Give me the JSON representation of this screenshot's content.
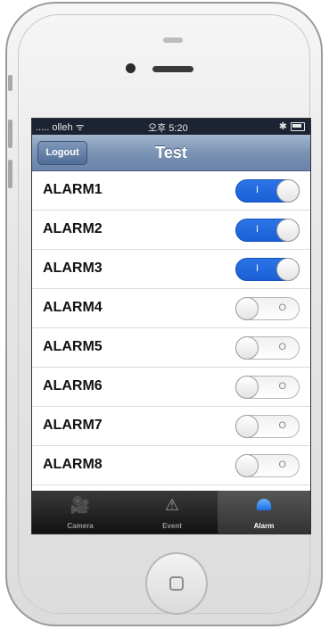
{
  "status": {
    "carrier": "..... olleh ᯤ",
    "time": "오후 5:20",
    "bluetooth": "✱"
  },
  "nav": {
    "logout_label": "Logout",
    "title": "Test"
  },
  "alarms": [
    {
      "label": "ALARM1",
      "on": true
    },
    {
      "label": "ALARM2",
      "on": true
    },
    {
      "label": "ALARM3",
      "on": true
    },
    {
      "label": "ALARM4",
      "on": false
    },
    {
      "label": "ALARM5",
      "on": false
    },
    {
      "label": "ALARM6",
      "on": false
    },
    {
      "label": "ALARM7",
      "on": false
    },
    {
      "label": "ALARM8",
      "on": false
    }
  ],
  "switch_marks": {
    "on": "I",
    "off": "O"
  },
  "tabs": [
    {
      "label": "Camera",
      "icon": "camera-icon",
      "active": false
    },
    {
      "label": "Event",
      "icon": "warning-icon",
      "active": false
    },
    {
      "label": "Alarm",
      "icon": "alarm-bell-icon",
      "active": true
    }
  ],
  "colors": {
    "switch_on": "#1a5fd6",
    "navbar": "#7b93b4",
    "tab_active": "#2e86ff"
  }
}
